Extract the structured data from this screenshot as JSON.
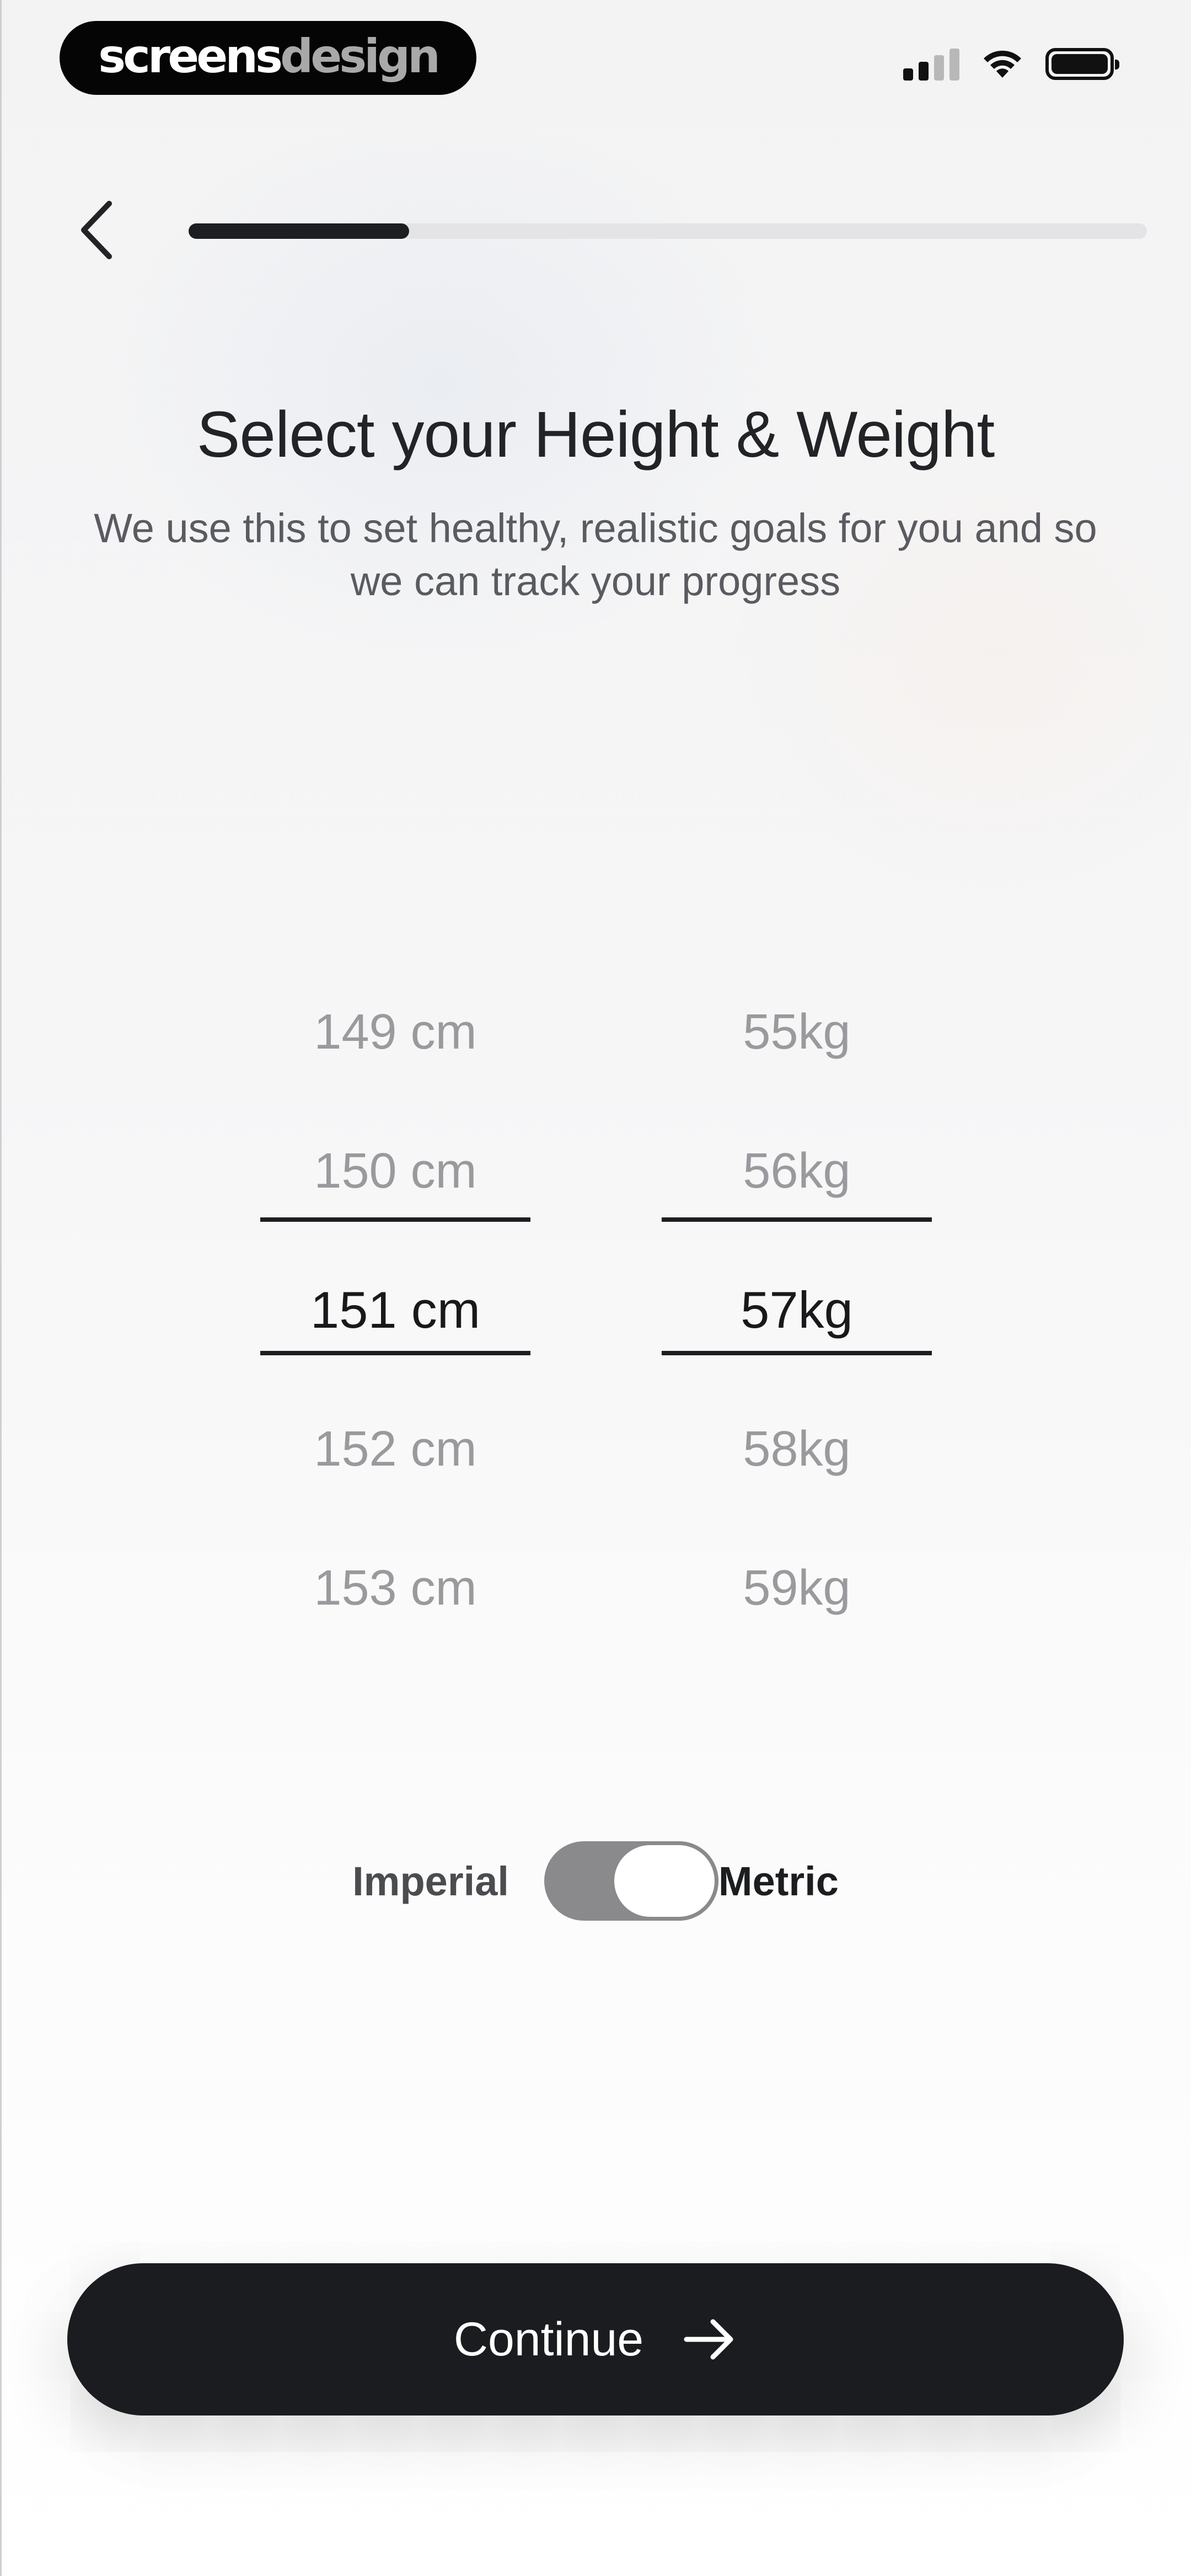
{
  "status_bar": {
    "brand_part1": "screens",
    "brand_part2": "design"
  },
  "header": {
    "progress_fraction": 0.23
  },
  "title": "Select your Height & Weight",
  "subtitle": "We use this to set healthy, realistic goals for you and so we can track your progress",
  "height_picker": {
    "items": [
      "149 cm",
      "150 cm",
      "151 cm",
      "152 cm",
      "153 cm"
    ],
    "selected": "151 cm"
  },
  "weight_picker": {
    "items": [
      "55kg",
      "56kg",
      "57kg",
      "58kg",
      "59kg"
    ],
    "selected": "57kg"
  },
  "unit_toggle": {
    "left_label": "Imperial",
    "right_label": "Metric",
    "selected": "Metric"
  },
  "continue_button": {
    "label": "Continue"
  },
  "colors": {
    "primary_dark": "#1b1c1f",
    "toggle_track": "#8a8a8c"
  }
}
